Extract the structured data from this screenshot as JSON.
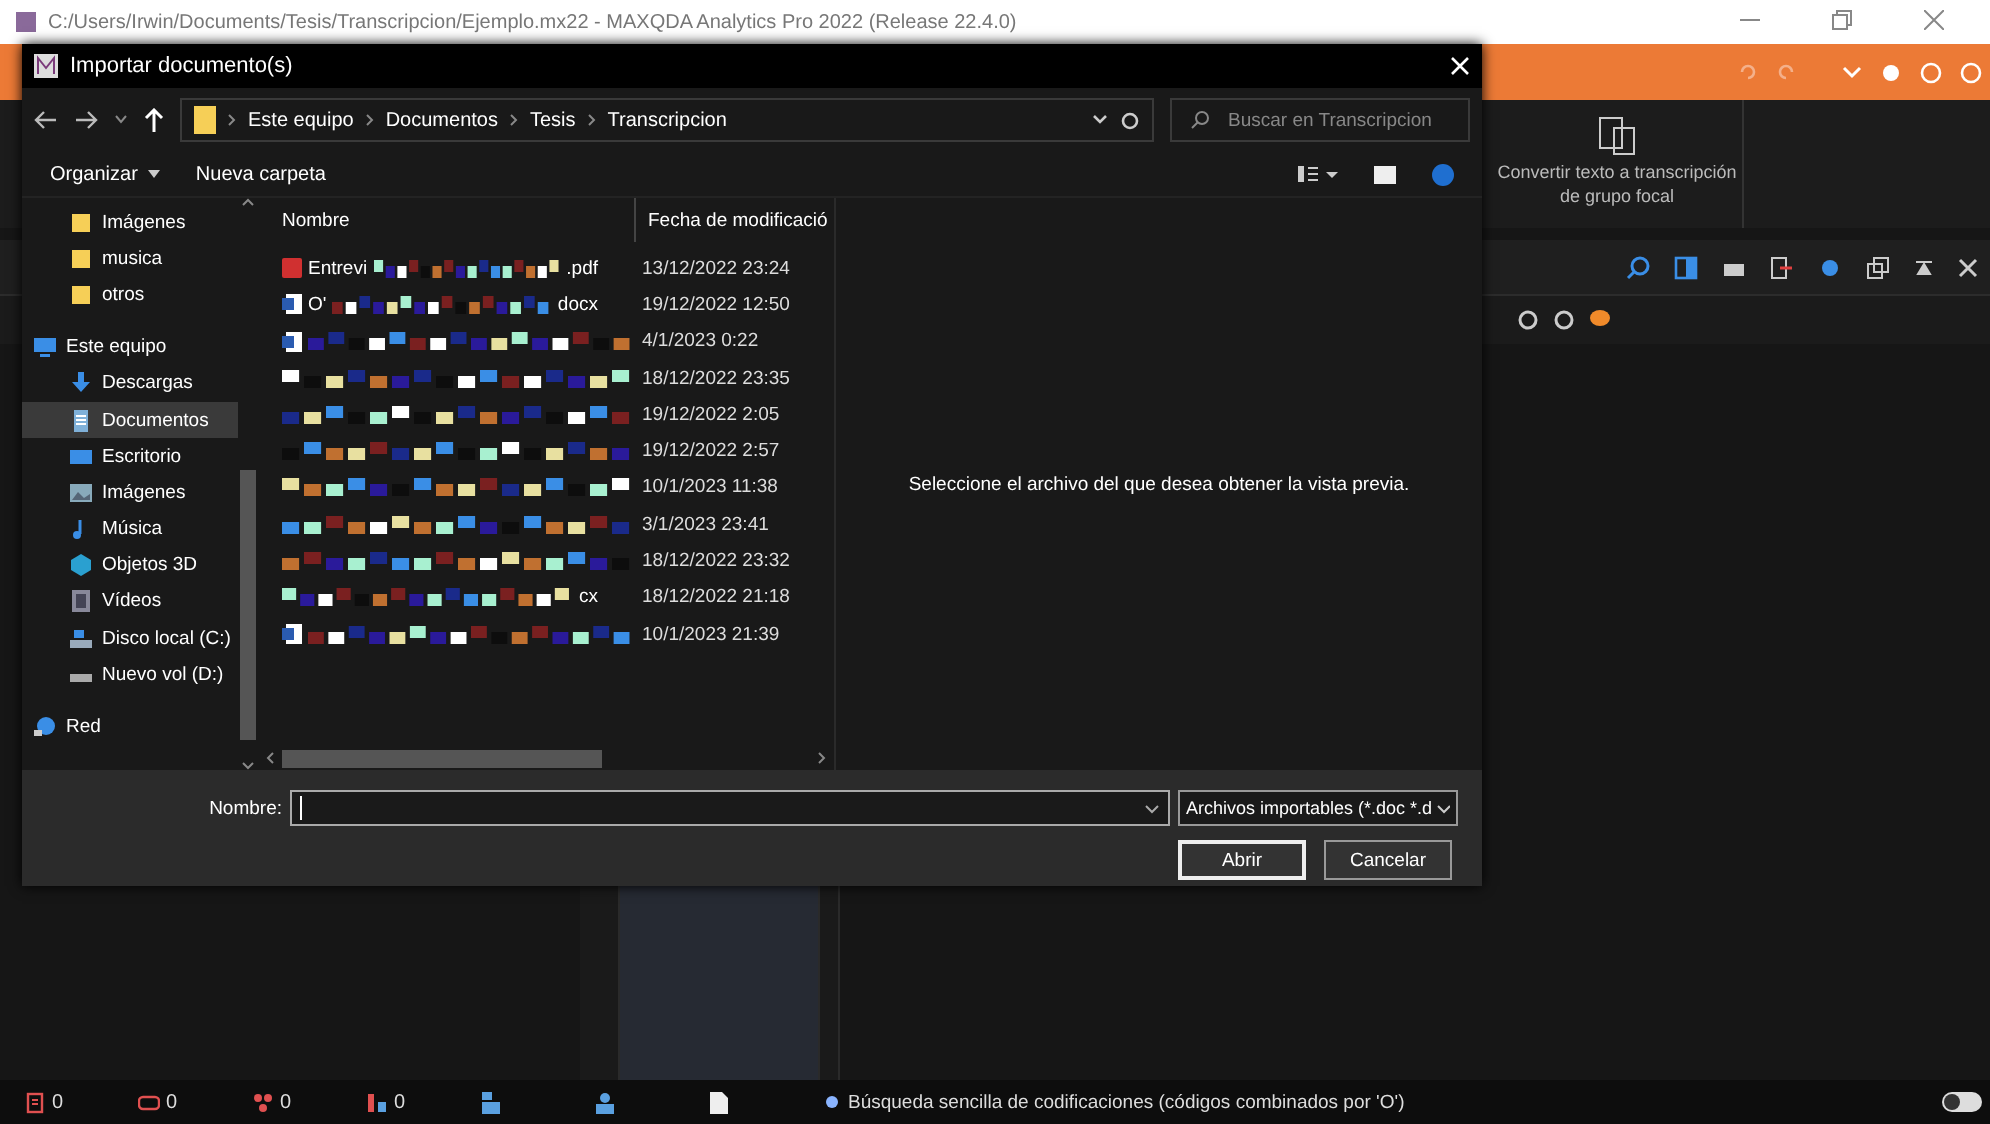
{
  "app": {
    "title": "C:/Users/Irwin/Documents/Tesis/Transcripcion/Ejemplo.mx22 - MAXQDA Analytics Pro 2022 (Release 22.4.0)",
    "ribbon_button": "Convertir texto a transcripción de grupo focal"
  },
  "dialog": {
    "title": "Importar documento(s)",
    "breadcrumb": [
      "Este equipo",
      "Documentos",
      "Tesis",
      "Transcripcion"
    ],
    "search": {
      "placeholder": "Buscar en Transcripcion"
    },
    "toolbar": {
      "organize": "Organizar",
      "new_folder": "Nueva carpeta"
    },
    "sidebar": [
      {
        "children": [
          {
            "label": "Imágenes",
            "kind": "folder",
            "selected": false
          },
          {
            "label": "musica",
            "kind": "folder",
            "selected": false
          },
          {
            "label": "otros",
            "kind": "folder",
            "selected": false
          }
        ]
      },
      {
        "label": "Este equipo",
        "kind": "pc",
        "selected": false,
        "children": [
          {
            "label": "Descargas",
            "kind": "download",
            "selected": false
          },
          {
            "label": "Documentos",
            "kind": "docs",
            "selected": true
          },
          {
            "label": "Escritorio",
            "kind": "desktop",
            "selected": false
          },
          {
            "label": "Imágenes",
            "kind": "pictures",
            "selected": false
          },
          {
            "label": "Música",
            "kind": "music",
            "selected": false
          },
          {
            "label": "Objetos 3D",
            "kind": "objects",
            "selected": false
          },
          {
            "label": "Vídeos",
            "kind": "videos",
            "selected": false
          },
          {
            "label": "Disco local (C:)",
            "kind": "drive",
            "selected": false
          },
          {
            "label": "Nuevo vol (D:)",
            "kind": "drive2",
            "selected": false
          }
        ]
      },
      {
        "label": "Red",
        "kind": "network",
        "selected": false
      }
    ],
    "columns": [
      "Nombre",
      "Fecha de modificació"
    ],
    "rows": [
      {
        "kind": "pdf",
        "name_start": "Entrevi",
        "name_end": ".pdf",
        "date": "13/12/2022 23:24"
      },
      {
        "kind": "word",
        "name_start": "O'",
        "name_end": "docx",
        "date": "19/12/2022 12:50"
      },
      {
        "kind": "word",
        "date": "4/1/2023 0:22"
      },
      {
        "kind": "blank",
        "date": "18/12/2022 23:35"
      },
      {
        "kind": "blank",
        "date": "19/12/2022 2:05"
      },
      {
        "kind": "blank",
        "date": "19/12/2022 2:57"
      },
      {
        "kind": "blank",
        "date": "10/1/2023 11:38"
      },
      {
        "kind": "blank",
        "date": "3/1/2023 23:41"
      },
      {
        "kind": "blank",
        "date": "18/12/2022 23:32"
      },
      {
        "kind": "blank",
        "name_end": "cx",
        "date": "18/12/2022 21:18"
      },
      {
        "kind": "word",
        "date": "10/1/2023 21:39"
      }
    ],
    "preview": "Seleccione el archivo del que desea obtener la vista previa.",
    "name_label": "Nombre:",
    "file_type": "Archivos importables (*.doc *.d",
    "buttons": [
      {
        "label": "Abrir",
        "default": true
      },
      {
        "label": "Cancelar",
        "default": false
      }
    ]
  },
  "status_bar": {
    "counts": [
      {
        "kind": "doc",
        "count": "0"
      },
      {
        "kind": "memo",
        "count": "0"
      },
      {
        "kind": "codes",
        "count": "0"
      },
      {
        "kind": "vars",
        "count": "0"
      }
    ],
    "message": "Búsqueda sencilla de codificaciones (códigos combinados por 'O')"
  }
}
